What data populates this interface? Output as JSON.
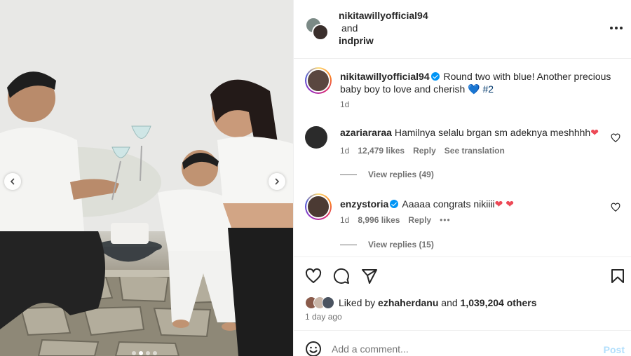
{
  "header": {
    "user1": "nikitawillyofficial94",
    "and": "and",
    "user2": "indpriw"
  },
  "caption": {
    "username": "nikitawillyofficial94",
    "text": "Round two with blue! Another precious baby boy to love and cherish",
    "heart": "💙",
    "hashtag": "#2",
    "time": "1d"
  },
  "comments": [
    {
      "username": "azariararaa",
      "text": "Hamilnya selalu brgan sm adeknya meshhhh",
      "emoji": "❤",
      "time": "1d",
      "likes": "12,479 likes",
      "reply": "Reply",
      "translate": "See translation",
      "view_replies": "View replies (49)"
    },
    {
      "username": "enzystoria",
      "text": "Aaaaa congrats nikiiii",
      "emoji": "❤ ❤",
      "time": "1d",
      "likes": "8,996 likes",
      "reply": "Reply",
      "view_replies": "View replies (15)"
    }
  ],
  "likes": {
    "prefix": "Liked by",
    "user": "ezhaherdanu",
    "and": "and",
    "count": "1,039,204 others"
  },
  "post_time": "1 day ago",
  "comment_box": {
    "placeholder": "Add a comment...",
    "post": "Post"
  },
  "carousel": {
    "slides": 4,
    "active": 2
  },
  "colors": {
    "verified": "#0095f6",
    "link": "#00376b",
    "post_disabled": "#b2dffc"
  }
}
